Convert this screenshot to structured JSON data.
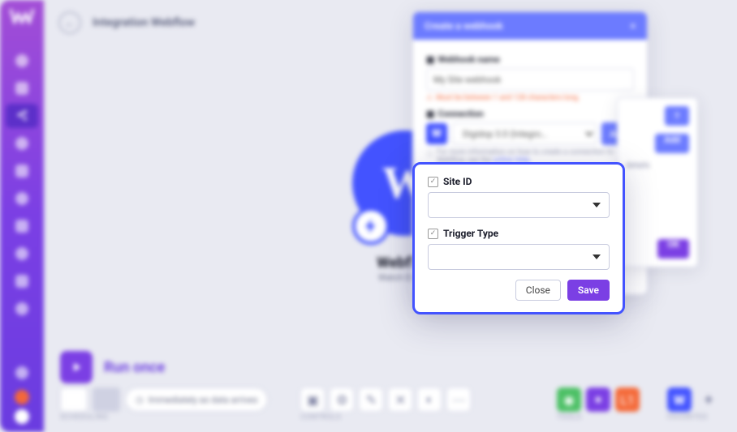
{
  "breadcrumb": "Integration Webflow",
  "webflow": {
    "title": "Webflow",
    "subtitle": "Watch Events"
  },
  "run": {
    "label": "Run once"
  },
  "bottom": {
    "scheduling_label": "SCHEDULING",
    "scheduling_text": "Immediately as data arrives",
    "controls_label": "CONTROLS",
    "tools_label": "TOOLS",
    "favorites_label": "FAVORITES"
  },
  "webhook_dialog": {
    "title": "Create a webhook",
    "name_label": "Webhook name",
    "name_value": "My Site webhook",
    "name_help": "Must be between 1 and 128 characters long.",
    "connection_label": "Connection",
    "connection_value": "Digidop 3.0 (Integro…",
    "add_label": "Add",
    "connection_help_pre": "For more information on how to create a connection to Webflow, see the ",
    "connection_help_link": "online Help"
  },
  "aux_panel": {
    "q": "?",
    "add": "Add",
    "text": "details",
    "ok": "OK"
  },
  "focus": {
    "site_label": "Site ID",
    "trigger_label": "Trigger Type",
    "close": "Close",
    "save": "Save"
  }
}
